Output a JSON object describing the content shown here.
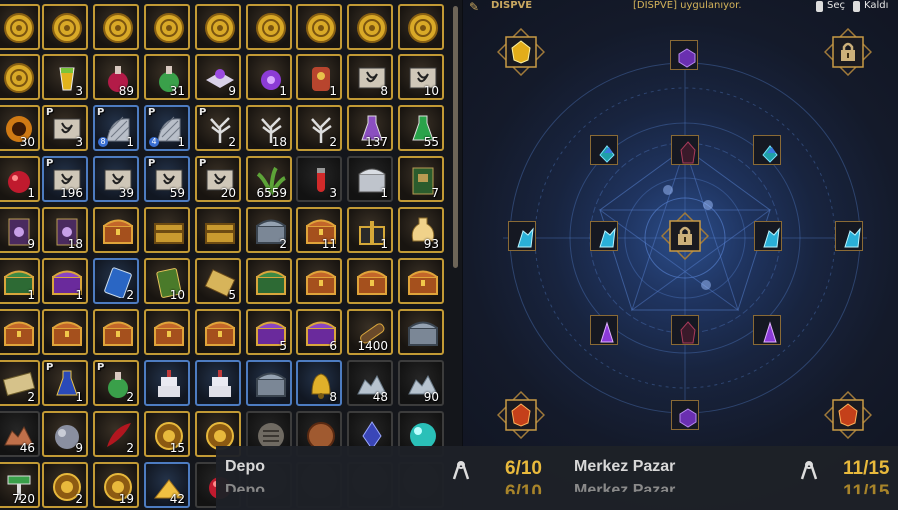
{
  "inventory": {
    "slots": [
      {
        "icon": "gold-coin-icon",
        "qty": "",
        "style": "gold"
      },
      {
        "icon": "gold-coin-icon",
        "qty": "",
        "style": "gold"
      },
      {
        "icon": "gold-coin-icon",
        "qty": "",
        "style": "gold"
      },
      {
        "icon": "gold-coin-icon",
        "qty": "",
        "style": "gold"
      },
      {
        "icon": "gold-coin-icon",
        "qty": "",
        "style": "gold"
      },
      {
        "icon": "gold-coin-icon",
        "qty": "",
        "style": "gold"
      },
      {
        "icon": "gold-coin-icon",
        "qty": "",
        "style": "gold"
      },
      {
        "icon": "gold-coin-icon",
        "qty": "",
        "style": "gold"
      },
      {
        "icon": "gold-coin-icon",
        "qty": "",
        "style": "gold"
      },
      {
        "icon": "gold-coin-icon",
        "qty": "",
        "style": "gold"
      },
      {
        "icon": "juice-glass-icon",
        "qty": "3",
        "style": "gold"
      },
      {
        "icon": "red-potion-icon",
        "qty": "89",
        "style": "gold"
      },
      {
        "icon": "green-potion-icon",
        "qty": "31",
        "style": "gold"
      },
      {
        "icon": "purple-book-icon",
        "qty": "9",
        "style": "gold"
      },
      {
        "icon": "purple-potion-icon",
        "qty": "1",
        "style": "gold"
      },
      {
        "icon": "red-idol-icon",
        "qty": "1",
        "style": "gold"
      },
      {
        "icon": "scroll-icon",
        "qty": "8",
        "style": "gold"
      },
      {
        "icon": "scroll-icon",
        "qty": "10",
        "style": "gold"
      },
      {
        "icon": "fire-ring-icon",
        "qty": "30",
        "style": "gold"
      },
      {
        "icon": "scroll-icon",
        "qty": "3",
        "style": "gold",
        "p": true
      },
      {
        "icon": "net-icon",
        "qty": "1",
        "style": "blue",
        "p": true,
        "num": "8"
      },
      {
        "icon": "net-icon",
        "qty": "1",
        "style": "blue",
        "p": true,
        "num": "4"
      },
      {
        "icon": "white-tree-icon",
        "qty": "2",
        "style": "gold",
        "p": true
      },
      {
        "icon": "white-tree-icon",
        "qty": "18",
        "style": "gold"
      },
      {
        "icon": "white-tree-icon",
        "qty": "2",
        "style": "gold"
      },
      {
        "icon": "purple-flask-icon",
        "qty": "137",
        "style": "gold"
      },
      {
        "icon": "green-flask-icon",
        "qty": "55",
        "style": "gold"
      },
      {
        "icon": "red-orb-icon",
        "qty": "1",
        "style": "gold"
      },
      {
        "icon": "scroll-icon",
        "qty": "196",
        "style": "blue",
        "p": true
      },
      {
        "icon": "scroll-icon",
        "qty": "39",
        "style": "blue"
      },
      {
        "icon": "scroll-icon",
        "qty": "59",
        "style": "blue",
        "p": true
      },
      {
        "icon": "scroll-icon",
        "qty": "20",
        "style": "gold",
        "p": true
      },
      {
        "icon": "green-plant-icon",
        "qty": "6559",
        "style": "gold"
      },
      {
        "icon": "red-vial-icon",
        "qty": "3",
        "style": "gray"
      },
      {
        "icon": "silver-chest-icon",
        "qty": "1",
        "style": "gray"
      },
      {
        "icon": "green-book-icon",
        "qty": "7",
        "style": "gold"
      },
      {
        "icon": "spell-book-icon",
        "qty": "9",
        "style": "gold"
      },
      {
        "icon": "spell-book-icon",
        "qty": "18",
        "style": "gold"
      },
      {
        "icon": "treasure-chest-icon",
        "qty": "",
        "style": "gold"
      },
      {
        "icon": "gold-chest-icon",
        "qty": "",
        "style": "gold"
      },
      {
        "icon": "gold-chest-icon",
        "qty": "",
        "style": "gold"
      },
      {
        "icon": "steel-chest-icon",
        "qty": "2",
        "style": "gold"
      },
      {
        "icon": "treasure-chest-icon",
        "qty": "11",
        "style": "gold"
      },
      {
        "icon": "gift-box-icon",
        "qty": "1",
        "style": "gold"
      },
      {
        "icon": "oil-flask-icon",
        "qty": "93",
        "style": "gold"
      },
      {
        "icon": "green-chest-icon",
        "qty": "1",
        "style": "gold"
      },
      {
        "icon": "purple-chest-icon",
        "qty": "1",
        "style": "gold"
      },
      {
        "icon": "blue-card-icon",
        "qty": "2",
        "style": "blue"
      },
      {
        "icon": "green-card-icon",
        "qty": "10",
        "style": "gold"
      },
      {
        "icon": "map-card-icon",
        "qty": "5",
        "style": "gold"
      },
      {
        "icon": "green-chest-icon",
        "qty": "",
        "style": "gold"
      },
      {
        "icon": "treasure-chest-icon",
        "qty": "",
        "style": "gold"
      },
      {
        "icon": "treasure-chest-icon",
        "qty": "",
        "style": "gold"
      },
      {
        "icon": "treasure-chest-icon",
        "qty": "",
        "style": "gold"
      },
      {
        "icon": "treasure-chest-icon",
        "qty": "",
        "style": "gold"
      },
      {
        "icon": "treasure-chest-icon",
        "qty": "",
        "style": "gold"
      },
      {
        "icon": "treasure-chest-icon",
        "qty": "",
        "style": "gold"
      },
      {
        "icon": "treasure-chest-icon",
        "qty": "",
        "style": "gold"
      },
      {
        "icon": "treasure-chest-icon",
        "qty": "",
        "style": "gold"
      },
      {
        "icon": "purple-chest-icon",
        "qty": "5",
        "style": "gold"
      },
      {
        "icon": "purple-chest-icon",
        "qty": "6",
        "style": "gold"
      },
      {
        "icon": "cannon-icon",
        "qty": "1400",
        "style": "gold"
      },
      {
        "icon": "steel-chest-icon",
        "qty": "",
        "style": "gold"
      },
      {
        "icon": "ticket-icon",
        "qty": "2",
        "style": "gold"
      },
      {
        "icon": "blue-flask-icon",
        "qty": "1",
        "style": "gold",
        "p": true
      },
      {
        "icon": "green-potion-icon",
        "qty": "2",
        "style": "gold",
        "p": true
      },
      {
        "icon": "cake-icon",
        "qty": "",
        "style": "blue"
      },
      {
        "icon": "cake-icon",
        "qty": "",
        "style": "blue"
      },
      {
        "icon": "steel-chest-icon",
        "qty": "",
        "style": "blue"
      },
      {
        "icon": "bell-icon",
        "qty": "8",
        "style": "blue"
      },
      {
        "icon": "silver-ore-icon",
        "qty": "48",
        "style": "gray"
      },
      {
        "icon": "silver-ore-icon",
        "qty": "90",
        "style": "gray"
      },
      {
        "icon": "copper-ore-icon",
        "qty": "46",
        "style": "gray"
      },
      {
        "icon": "ore-sack-icon",
        "qty": "9",
        "style": "gold"
      },
      {
        "icon": "red-feather-icon",
        "qty": "2",
        "style": "gold"
      },
      {
        "icon": "gold-medal-icon",
        "qty": "15",
        "style": "gold"
      },
      {
        "icon": "gold-medal-icon",
        "qty": "",
        "style": "gold"
      },
      {
        "icon": "stone-tablet-icon",
        "qty": "",
        "style": "gray"
      },
      {
        "icon": "copper-coin-icon",
        "qty": "",
        "style": "gray"
      },
      {
        "icon": "blue-gem-icon",
        "qty": "",
        "style": "gray"
      },
      {
        "icon": "cyan-orb-icon",
        "qty": "",
        "style": "gray"
      },
      {
        "icon": "green-hammer-icon",
        "qty": "720",
        "style": "gold"
      },
      {
        "icon": "gold-medal-icon",
        "qty": "2",
        "style": "gold"
      },
      {
        "icon": "gold-medal-icon",
        "qty": "19",
        "style": "gold"
      },
      {
        "icon": "gold-pile-icon",
        "qty": "42",
        "style": "blue"
      },
      {
        "icon": "red-orb-icon",
        "qty": "",
        "style": "gray"
      },
      {
        "icon": "",
        "qty": "",
        "style": "gray"
      },
      {
        "icon": "",
        "qty": "",
        "style": "gray"
      },
      {
        "icon": "",
        "qty": "",
        "style": "gray"
      },
      {
        "icon": "",
        "qty": "",
        "style": "gray"
      }
    ],
    "p_label": "P"
  },
  "topbar": {
    "left_label": "DISPVE",
    "center_text": "[DISPVE] uygulanıyor.",
    "right_select": "Seç",
    "right_remove": "Kaldı"
  },
  "panel": {
    "sockets": [
      {
        "icon": "yellow-gem-icon",
        "frame": "ornate"
      },
      {
        "icon": "purple-gem-icon",
        "frame": "plain"
      },
      {
        "icon": "lock-icon",
        "frame": "ornate"
      },
      {
        "icon": "blue-green-gem-icon",
        "frame": "plain"
      },
      {
        "icon": "dark-red-gem-icon",
        "frame": "plain"
      },
      {
        "icon": "blue-green-gem-icon",
        "frame": "plain"
      },
      {
        "icon": "cyan-crystal-icon",
        "frame": "plain"
      },
      {
        "icon": "cyan-crystal-icon",
        "frame": "plain"
      },
      {
        "icon": "lock-icon",
        "frame": "ornate"
      },
      {
        "icon": "cyan-crystal-icon",
        "frame": "plain"
      },
      {
        "icon": "cyan-crystal-icon",
        "frame": "plain"
      },
      {
        "icon": "purple-crystal-icon",
        "frame": "plain"
      },
      {
        "icon": "dark-red-gem-icon",
        "frame": "plain"
      },
      {
        "icon": "purple-crystal-icon",
        "frame": "plain"
      },
      {
        "icon": "orange-gem-icon",
        "frame": "ornate"
      },
      {
        "icon": "purple-gem-icon",
        "frame": "plain"
      },
      {
        "icon": "orange-gem-icon",
        "frame": "ornate"
      }
    ]
  },
  "storage": {
    "depo_label": "Depo",
    "depo_count": "6/10",
    "pazar_label": "Merkez Pazar",
    "pazar_count": "11/15"
  },
  "colors": {
    "accent_gold": "#c29a35",
    "count_yellow": "#e8b93c",
    "storage_text": "#d8d8d8"
  }
}
